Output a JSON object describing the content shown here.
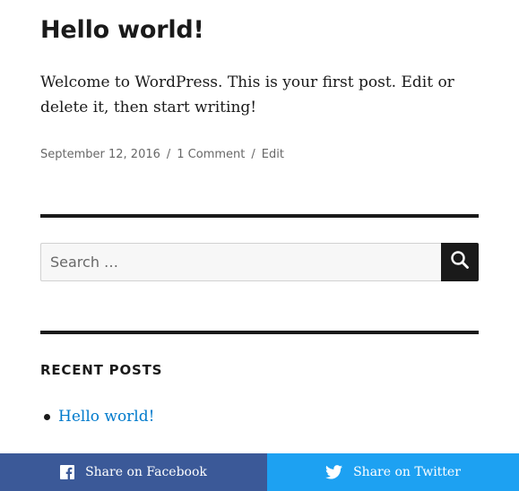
{
  "post": {
    "title": "Hello world!",
    "body": "Welcome to WordPress. This is your first post. Edit or delete it, then start writing!",
    "date": "September 12, 2016",
    "separator": "/",
    "comments": "1 Comment",
    "edit": "Edit"
  },
  "search": {
    "placeholder": "Search …",
    "icon": "search-icon"
  },
  "widget": {
    "title": "RECENT POSTS",
    "items": [
      {
        "label": "Hello world!"
      }
    ]
  },
  "share": {
    "facebook": {
      "label": "Share on Facebook",
      "icon": "facebook-icon",
      "color": "#3b5998"
    },
    "twitter": {
      "label": "Share on Twitter",
      "icon": "twitter-icon",
      "color": "#1da1f2"
    }
  },
  "colors": {
    "text": "#1a1a1a",
    "meta": "#686868",
    "link": "#007acc"
  }
}
